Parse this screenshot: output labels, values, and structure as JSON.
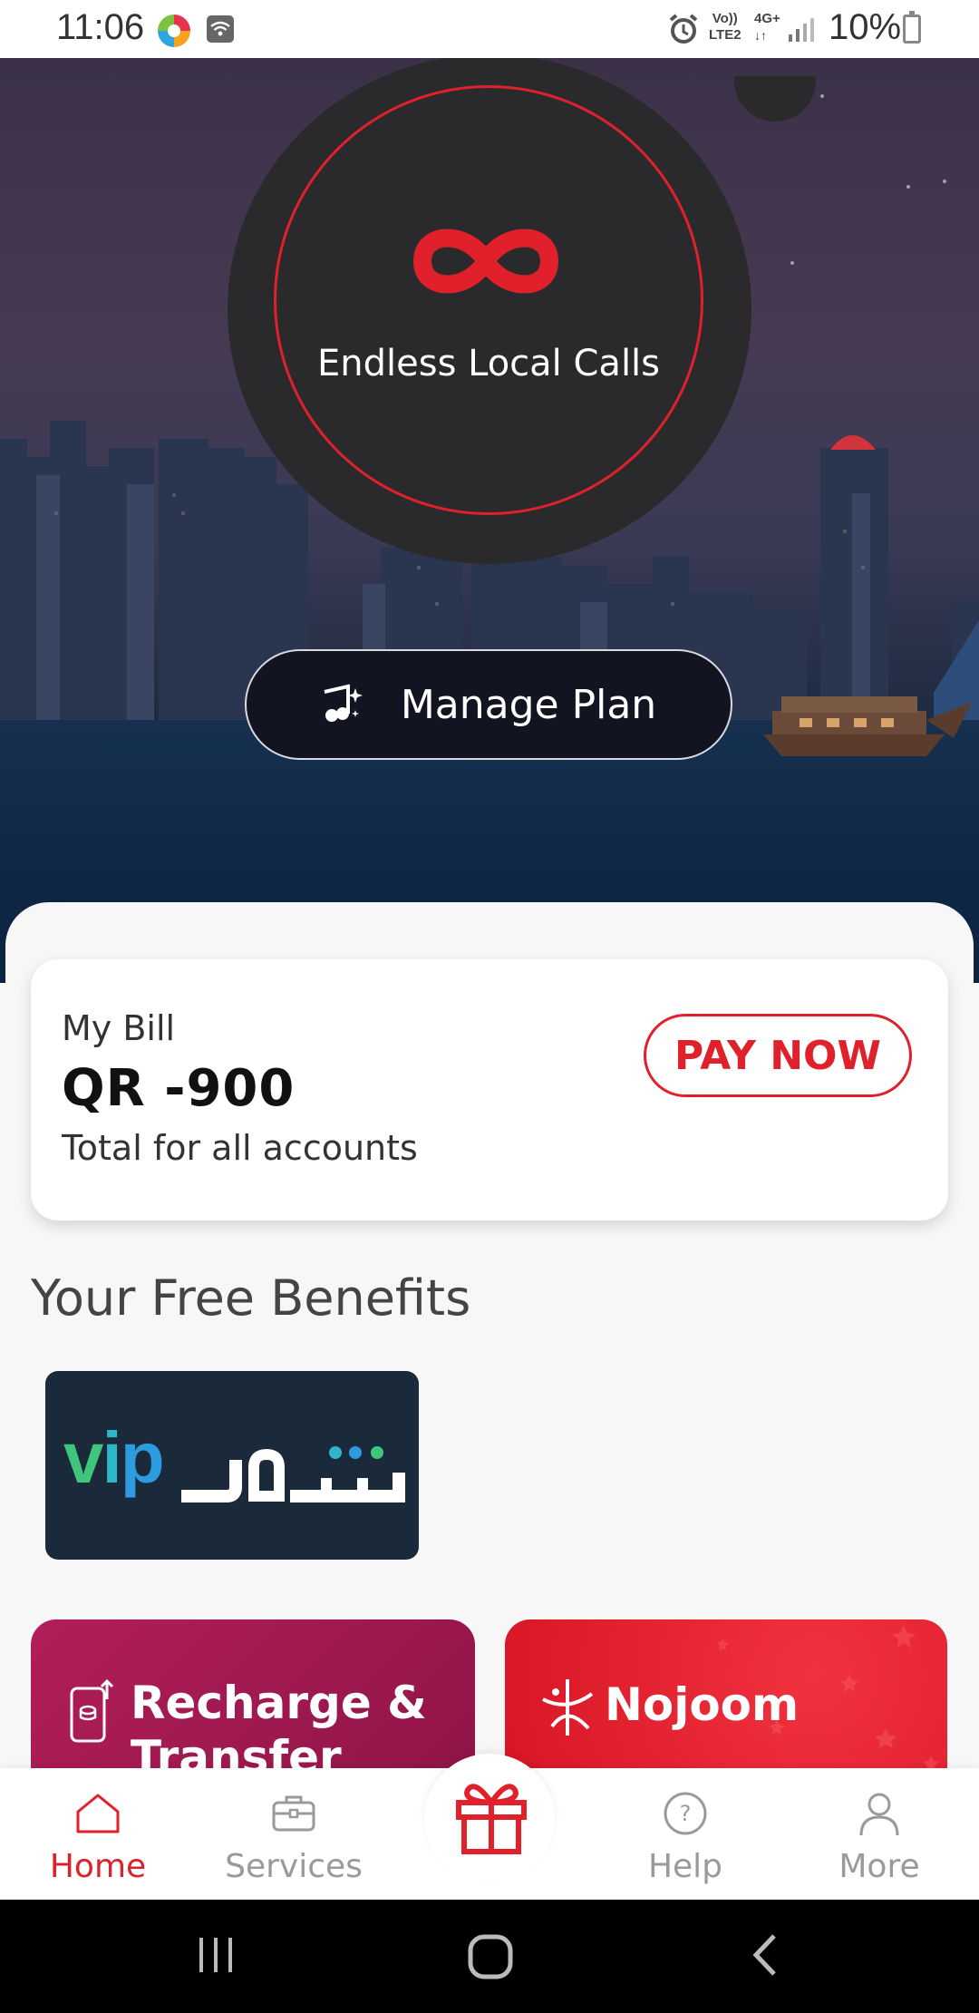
{
  "status_bar": {
    "time": "11:06",
    "network_volte": "Vo))",
    "network_lte": "LTE2",
    "network_type": "4G+",
    "battery": "10%"
  },
  "hero": {
    "plan_name": "Endless Local Calls",
    "plan_icon": "infinity-icon",
    "manage_label": "Manage Plan"
  },
  "bill": {
    "title": "My Bill",
    "amount": "QR -900",
    "subtitle": "Total for all accounts",
    "pay_label": "PAY NOW"
  },
  "benefits": {
    "title": "Your Free Benefits",
    "items": [
      {
        "brand": "vip",
        "icon": "shahid-vip-logo"
      }
    ]
  },
  "tiles": {
    "recharge": {
      "label": "Recharge & Transfer",
      "icon": "phone-recharge-icon"
    },
    "nojoom": {
      "label": "Nojoom",
      "icon": "nojoom-star-icon"
    }
  },
  "bottom_nav": {
    "items": [
      {
        "label": "Home",
        "icon": "home-icon",
        "active": true
      },
      {
        "label": "Services",
        "icon": "briefcase-icon",
        "active": false
      },
      {
        "label": "",
        "icon": "gift-icon",
        "active": false
      },
      {
        "label": "Help",
        "icon": "help-icon",
        "active": false
      },
      {
        "label": "More",
        "icon": "user-icon",
        "active": false
      }
    ]
  },
  "colors": {
    "accent": "#e0202a",
    "recharge_tile": "#a81852",
    "nojoom_tile": "#e11f2d",
    "card_bg": "#ffffff",
    "hero_circle": "#2a2a2c"
  }
}
